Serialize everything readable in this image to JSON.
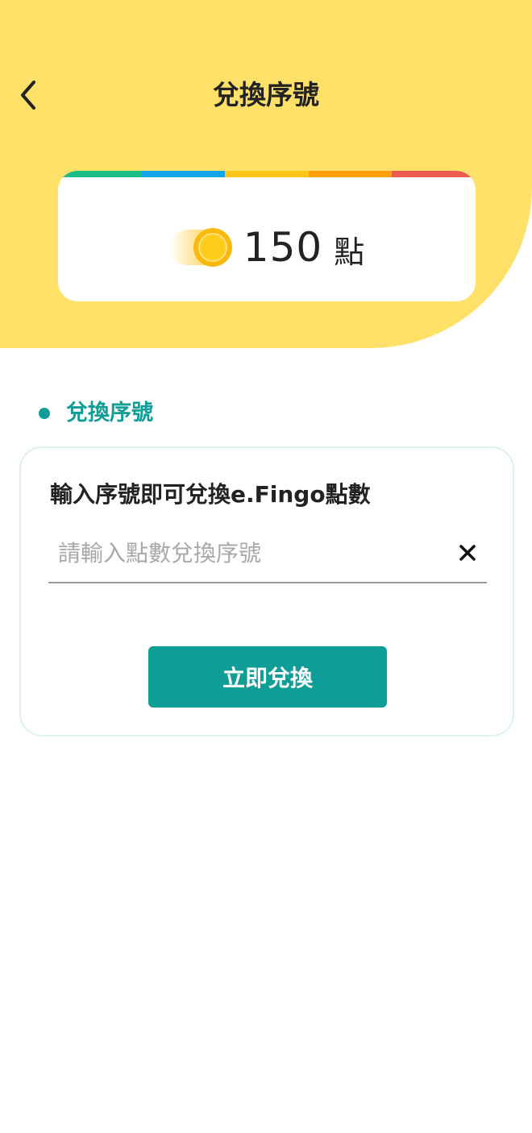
{
  "header": {
    "title": "兌換序號",
    "back_icon": "chevron-left-icon",
    "background_color": "#FFE16A"
  },
  "points_card": {
    "value": "150",
    "unit": "點",
    "coin_icon": "coin-icon",
    "strip_colors": [
      "#1DBE86",
      "#13A5E8",
      "#FFC61A",
      "#FF9F0E",
      "#EE5A4F"
    ]
  },
  "section": {
    "label": "兌換序號",
    "accent_color": "#0E9E97"
  },
  "redeem_form": {
    "title": "輸入序號即可兌換e.Fingo點數",
    "input_value": "",
    "input_placeholder": "請輸入點數兌換序號",
    "clear_icon": "close-icon",
    "submit_label": "立即兌換"
  }
}
